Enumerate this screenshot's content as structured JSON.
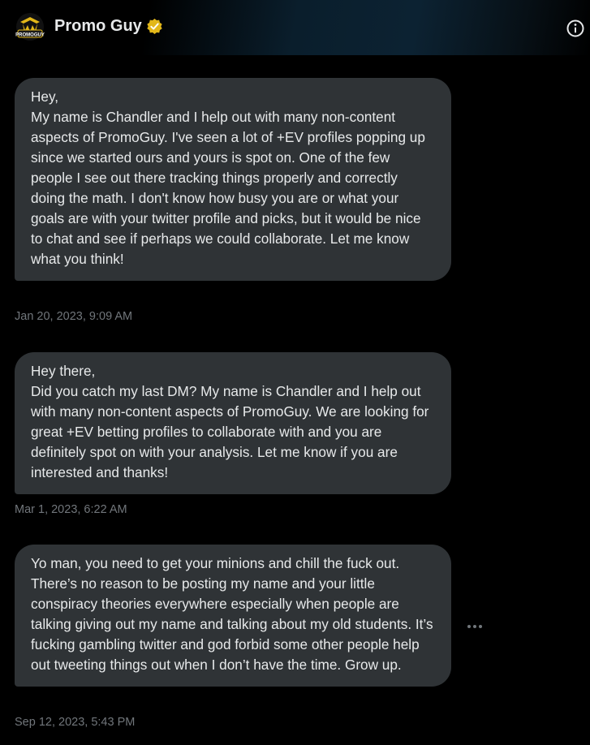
{
  "header": {
    "name": "Promo Guy",
    "avatar_text": "PROMOGUY",
    "verified_color": "#e2b719",
    "avatar_icon": "promoguy-logo-icon",
    "info_icon": "info-icon"
  },
  "messages": [
    {
      "text": "Hey,\nMy name is Chandler and I help out with many non-content aspects of PromoGuy. I've seen a lot of +EV profiles popping up since we started ours and yours is spot on. One of the few people I see out there tracking things properly and correctly doing the math. I don't know how busy you are or what your goals are with your twitter profile and picks, but it would be nice to chat and see if perhaps we could collaborate. Let me know what you think!",
      "timestamp": "Jan 20, 2023, 9:09 AM"
    },
    {
      "text": "Hey there,\nDid you catch my last DM? My name is Chandler and I help out with many non-content aspects of PromoGuy. We are looking for great +EV betting profiles to collaborate with and you are definitely spot on with your analysis. Let me know if you are interested and thanks!",
      "timestamp": "Mar 1, 2023, 6:22 AM"
    },
    {
      "text": "Yo man, you need to get your minions and chill the fuck out. There’s no reason to be posting my name and your little conspiracy theories everywhere especially when people are talking giving out my name and talking about my old students. It’s fucking gambling twitter and god forbid some other people help out tweeting things out when I don’t have the time. Grow up.",
      "timestamp": "Sep 12, 2023, 5:43 PM"
    }
  ],
  "colors": {
    "bubble": "#2f3336",
    "text": "#e7e9ea",
    "timestamp": "#71767b",
    "background": "#000000"
  },
  "more_icon": "more-options-icon"
}
